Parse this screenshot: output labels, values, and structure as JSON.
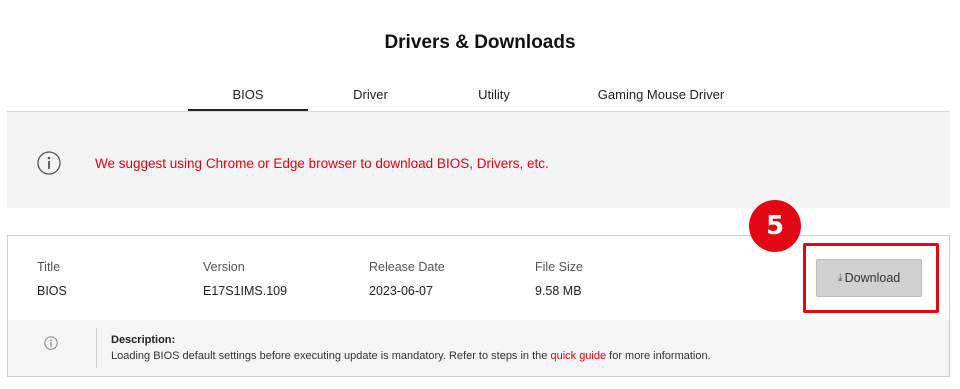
{
  "page_title": "Drivers & Downloads",
  "tabs": [
    {
      "label": "BIOS",
      "active": true
    },
    {
      "label": "Driver",
      "active": false
    },
    {
      "label": "Utility",
      "active": false
    },
    {
      "label": "Gaming Mouse Driver",
      "active": false
    }
  ],
  "notice": {
    "icon": "info-circle-icon",
    "text": "We suggest using Chrome or Edge browser to download BIOS, Drivers, etc."
  },
  "file_entry": {
    "columns": {
      "title_label": "Title",
      "version_label": "Version",
      "release_label": "Release Date",
      "size_label": "File Size"
    },
    "values": {
      "title": "BIOS",
      "version": "E17S1IMS.109",
      "release_date": "2023-06-07",
      "file_size": "9.58 MB"
    },
    "download_button": {
      "glyph": "⤓",
      "label": "Download"
    },
    "description": {
      "heading": "Description:",
      "text_before": "Loading BIOS default settings before executing update is mandatory. Refer to steps in the ",
      "link_text": "quick guide",
      "text_after": " for more information."
    }
  },
  "annotation": {
    "step_number": "5",
    "highlight_color": "#e30613"
  },
  "colors": {
    "accent_red": "#e60012",
    "notice_bg": "#f3f3f3",
    "button_bg": "#d1d1d1"
  }
}
